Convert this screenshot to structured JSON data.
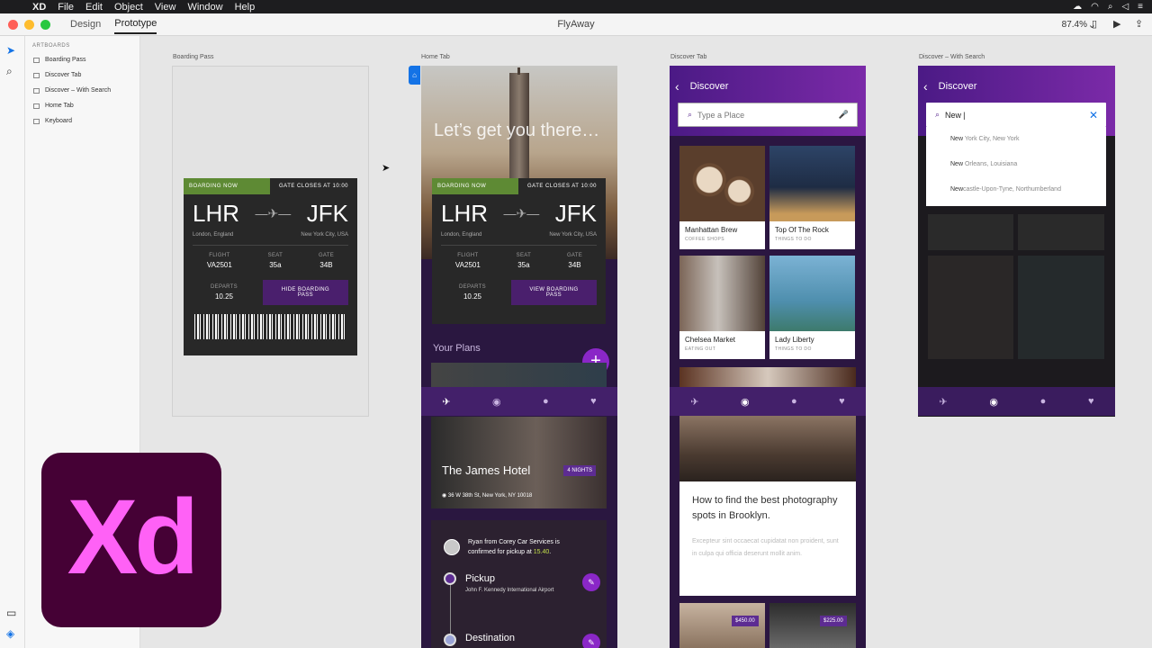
{
  "menubar": {
    "app": "XD",
    "items": [
      "File",
      "Edit",
      "Object",
      "View",
      "Window",
      "Help"
    ]
  },
  "titlebar": {
    "tabs": [
      "Design",
      "Prototype"
    ],
    "active": "Prototype",
    "title": "FlyAway",
    "zoom": "87.4%"
  },
  "layers": {
    "header": "ARTBOARDS",
    "items": [
      "Boarding Pass",
      "Discover Tab",
      "Discover – With Search",
      "Home Tab",
      "Keyboard"
    ]
  },
  "artboards": {
    "boarding": "Boarding Pass",
    "home": "Home Tab",
    "discover": "Discover Tab",
    "discover_search": "Discover – With Search"
  },
  "pass": {
    "status": "BOARDING NOW",
    "gate_closes": "GATE CLOSES AT 10:00",
    "from": "LHR",
    "to": "JFK",
    "from_city": "London, England",
    "to_city": "New York City, USA",
    "flight_label": "FLIGHT",
    "flight": "VA2501",
    "seat_label": "SEAT",
    "seat": "35a",
    "gate_label": "GATE",
    "gate": "34B",
    "departs_label": "DEPARTS",
    "departs": "10.25",
    "hide_btn": "HIDE BOARDING PASS",
    "view_btn": "VIEW BOARDING PASS"
  },
  "home": {
    "hero": "Let’s get you there…",
    "plans": "Your Plans",
    "fab": "+",
    "hotel": {
      "name": "The James Hotel",
      "nights": "4 NIGHTS",
      "address": "36 W 38th St, New York, NY 10018"
    },
    "ride": {
      "msg_a": "Ryan from Corey Car Services is confirmed for pickup at ",
      "time": "15.40",
      "msg_b": "."
    },
    "pickup": {
      "label": "Pickup",
      "place": "John F. Kennedy International Airport"
    },
    "destination": {
      "label": "Destination"
    }
  },
  "discover": {
    "title": "Discover",
    "placeholder": "Type a Place",
    "tiles": [
      {
        "name": "Manhattan Brew",
        "cat": "COFFEE SHOPS",
        "color": "#7a5a42"
      },
      {
        "name": "Top Of The Rock",
        "cat": "THINGS TO DO",
        "color": "#2a3b55"
      },
      {
        "name": "Chelsea Market",
        "cat": "EATING OUT",
        "color": "#6c5a4e"
      },
      {
        "name": "Lady Liberty",
        "cat": "THINGS TO DO",
        "color": "#3f7a8c"
      }
    ],
    "article": {
      "heading": "How to find the best photography spots in Brooklyn.",
      "body": "Excepteur sint occaecat cupidatat non proident, sunt in culpa qui officia deserunt mollit anim."
    },
    "prices": [
      "$450.00",
      "$225.00"
    ]
  },
  "search": {
    "title": "Discover",
    "query": "New",
    "results": [
      {
        "bold": "New",
        "rest": " York City, New York"
      },
      {
        "bold": "New",
        "rest": " Orleans, Louisiana"
      },
      {
        "bold": "New",
        "rest": "castle-Upon-Tyne, Northumberland"
      }
    ]
  },
  "logo": "Xd",
  "colors": {
    "purple": "#5d2c92",
    "green": "#5e8a34",
    "fab": "#8a27c7",
    "logo_bg": "#450135",
    "logo_fg": "#ff61f6"
  }
}
